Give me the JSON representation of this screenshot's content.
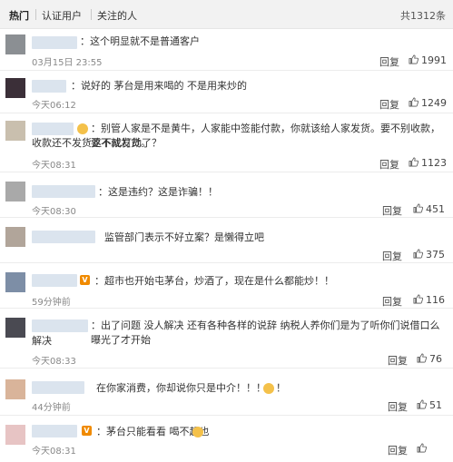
{
  "tabs": [
    {
      "label": "热门"
    },
    {
      "label": "认证用户"
    },
    {
      "label": "关注的人"
    }
  ],
  "total": "共1312条",
  "actions": {
    "reply_label": "回复"
  },
  "comments": [
    {
      "text": "：这个明显就不是普通客户",
      "time": "03月15日 23:55",
      "likes": "1991"
    },
    {
      "text": "：说好的 茅台是用来喝的 不是用来炒的",
      "time": "今天06:12",
      "likes": "1249"
    },
    {
      "text_line1": "：别管人家是不是黄牛，人家能中签能付款，你就该给人家发货。要不别收款，要不就发货。",
      "text_line2": "收款还不发货这不成打劫了？",
      "time": "今天08:31",
      "likes": "1123"
    },
    {
      "text": "：这是违约？这是诈骗！！",
      "time": "今天08:30",
      "likes": "451"
    },
    {
      "text": "监管部门表示不好立案？是懒得立吧",
      "time": "今天08:31",
      "likes": "375"
    },
    {
      "text": "：超市也开始屯茅台，炒酒了，现在是什么都能炒！！",
      "time": "59分钟前",
      "likes": "116"
    },
    {
      "text_line1": "：出了问题 没人解决 还有各种各样的说辞 纳税人养你们是为了听你们说借口么 曝光了才开始",
      "text_line2": "解决",
      "time": "今天08:33",
      "likes": "76"
    },
    {
      "text": "在你家消费，你却说你只是中介！！！！！",
      "time": "44分钟前",
      "likes": "51"
    },
    {
      "text": "：茅台只能看看 喝不起也",
      "time": "今天08:31",
      "likes": ""
    }
  ]
}
